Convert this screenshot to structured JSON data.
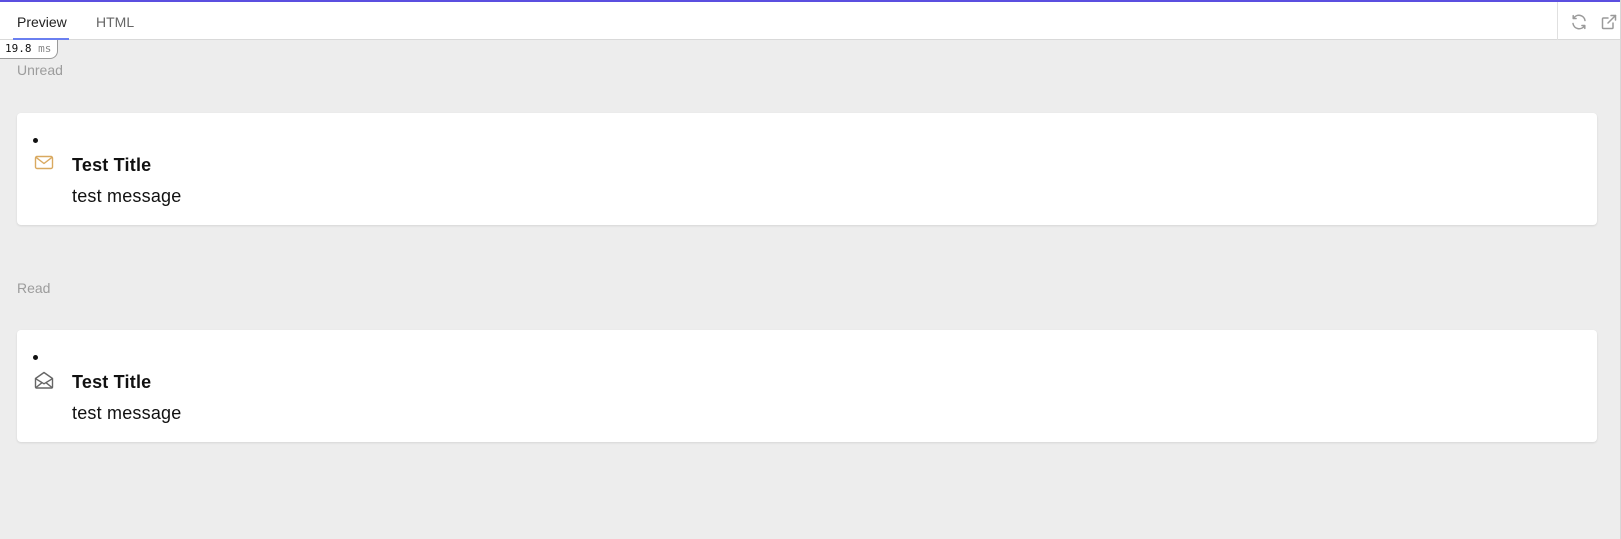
{
  "tabs": {
    "preview": "Preview",
    "html": "HTML"
  },
  "toolbar": {
    "refresh_icon": "refresh-icon",
    "popout_icon": "external-link-icon"
  },
  "timing": {
    "value": "19.8",
    "unit": "ms"
  },
  "sections": {
    "unread": {
      "label": "Unread",
      "notification": {
        "icon": "envelope-closed-icon",
        "icon_color": "#d9a960",
        "title": "Test Title",
        "message": "test message"
      }
    },
    "read": {
      "label": "Read",
      "notification": {
        "icon": "envelope-open-icon",
        "icon_color": "#666666",
        "title": "Test Title",
        "message": "test message"
      }
    }
  },
  "colors": {
    "accent": "#5b4fe0",
    "tab_underline": "#6a7ff0",
    "background": "#ededed"
  }
}
